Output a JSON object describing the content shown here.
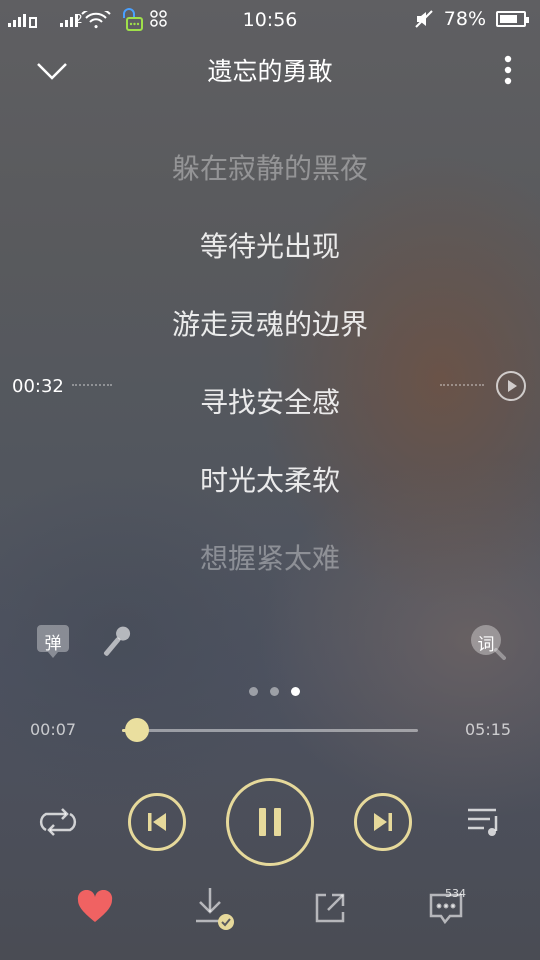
{
  "status_bar": {
    "network_1": "2",
    "time": "10:56",
    "battery_percent": "78%",
    "battery_level": 0.78,
    "icons": [
      "signal-icon",
      "signal-2-icon",
      "wifi-icon",
      "chat-notification-icon",
      "mute-icon",
      "battery-icon"
    ]
  },
  "header": {
    "title": "遗忘的勇敢",
    "collapse_icon": "chevron-down-icon",
    "more_icon": "more-vertical-icon"
  },
  "lyrics": [
    {
      "text": "躲在寂静的黑夜",
      "style": "dim"
    },
    {
      "text": "等待光出现",
      "style": "bright"
    },
    {
      "text": "游走灵魂的边界",
      "style": "bright"
    },
    {
      "text": "寻找安全感",
      "style": "bright"
    },
    {
      "text": "时光太柔软",
      "style": "bright"
    },
    {
      "text": "想握紧太难",
      "style": "dim"
    }
  ],
  "seek_line": {
    "time": "00:32",
    "play_icon": "play-circle-icon"
  },
  "tools": {
    "danmaku_label": "弹",
    "lyrics_label": "词",
    "mic_icon": "microphone-icon"
  },
  "pager": {
    "count": 3,
    "active_index": 2
  },
  "progress": {
    "current": "00:07",
    "total": "05:15",
    "fraction": 0.022
  },
  "controls": {
    "repeat_icon": "repeat-icon",
    "prev_icon": "skip-previous-icon",
    "play_pause_icon": "pause-icon",
    "next_icon": "skip-next-icon",
    "playlist_icon": "playlist-icon"
  },
  "bottom_bar": {
    "like_icon": "heart-icon",
    "download_icon": "downloaded-icon",
    "share_icon": "share-icon",
    "comment_icon": "comment-icon",
    "comment_count": "534"
  },
  "colors": {
    "accent": "#e6d99b",
    "like": "#f06262"
  }
}
